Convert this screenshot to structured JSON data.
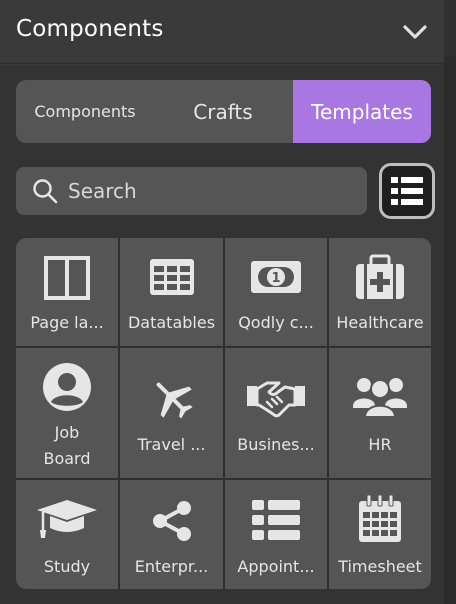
{
  "header": {
    "title": "Components"
  },
  "tabs": [
    {
      "label": "Components",
      "active": false
    },
    {
      "label": "Crafts",
      "active": false
    },
    {
      "label": "Templates",
      "active": true
    }
  ],
  "search": {
    "placeholder": "Search"
  },
  "colors": {
    "accent": "#a977e2",
    "tile": "#555555",
    "background": "#333333"
  },
  "templates": [
    {
      "label": "Page la...",
      "icon": "columns-icon"
    },
    {
      "label": "Datatables",
      "icon": "table-icon"
    },
    {
      "label": "Qodly c...",
      "icon": "banknote-icon"
    },
    {
      "label": "Healthcare",
      "icon": "medical-kit-icon"
    },
    {
      "label": "Job Board",
      "icon": "user-circle-icon"
    },
    {
      "label": "Travel ...",
      "icon": "plane-icon"
    },
    {
      "label": "Busines...",
      "icon": "handshake-icon"
    },
    {
      "label": "HR",
      "icon": "users-icon"
    },
    {
      "label": "Study",
      "icon": "graduation-cap-icon"
    },
    {
      "label": "Enterpr...",
      "icon": "share-icon"
    },
    {
      "label": "Appoint...",
      "icon": "list-icon"
    },
    {
      "label": "Timesheet",
      "icon": "calendar-icon"
    }
  ]
}
